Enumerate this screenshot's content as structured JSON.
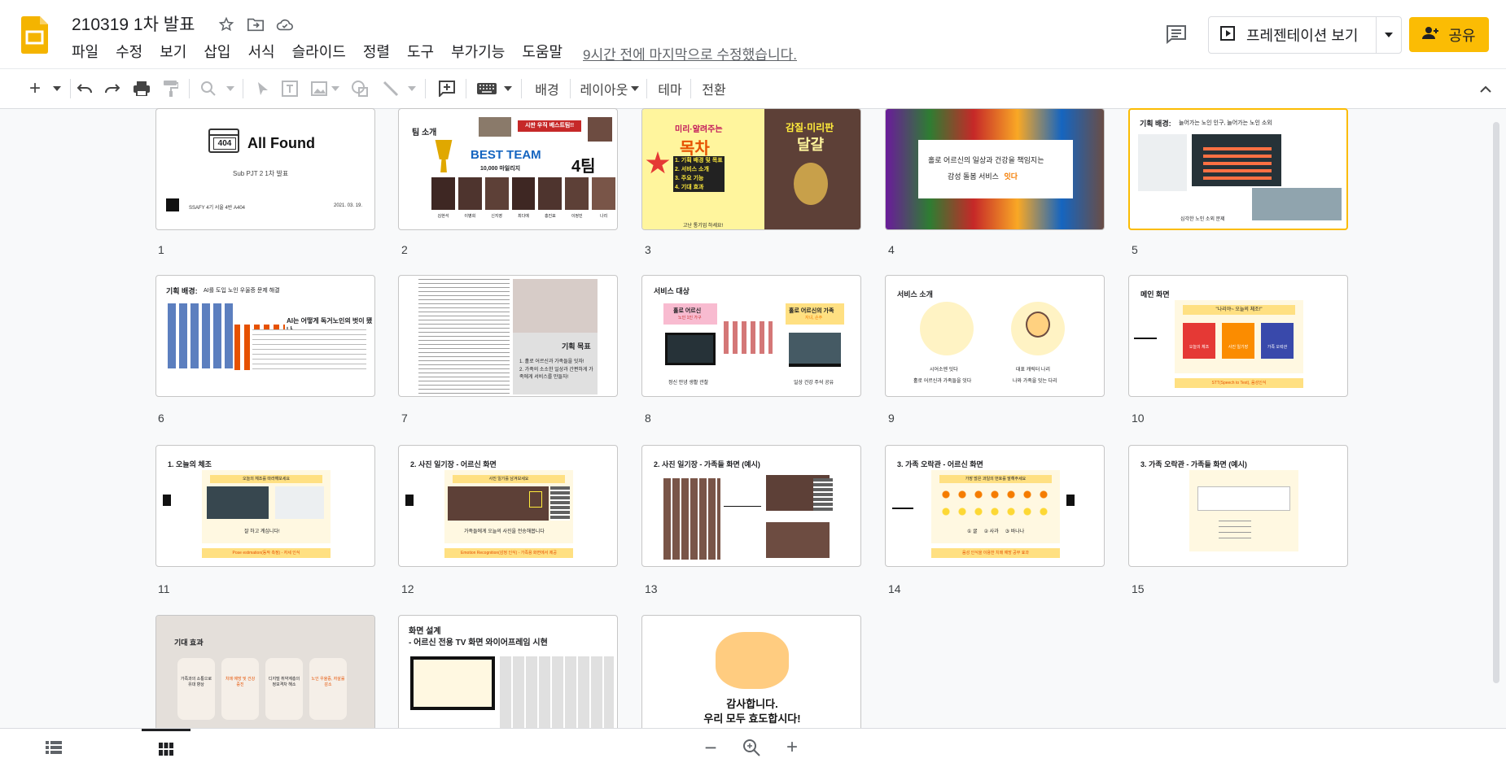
{
  "doc": {
    "title": "210319 1차 발표",
    "last_edit": "9시간 전에 마지막으로 수정했습니다."
  },
  "menu": [
    "파일",
    "수정",
    "보기",
    "삽입",
    "서식",
    "슬라이드",
    "정렬",
    "도구",
    "부가기능",
    "도움말"
  ],
  "header": {
    "present_label": "프레젠테이션 보기",
    "share_label": "공유"
  },
  "toolbar": {
    "background": "배경",
    "layout": "레이아웃",
    "theme": "테마",
    "transition": "전환"
  },
  "colors": {
    "accent": "#fbbc04",
    "logo": "#f4b400"
  },
  "slides": [
    {
      "n": "1",
      "title": "All Found",
      "subtitle": "Sub PJT 2 1차 발표",
      "footer": "SSAFY 4기 서울 4반 A404",
      "date": "2021. 03. 19.",
      "badge": "404"
    },
    {
      "n": "2",
      "title": "팀 소개",
      "headline": "BEST TEAM",
      "sub": "10,000 마일리지",
      "team": "4팀",
      "banner": "시판 우직 베스트팀!!",
      "members": [
        "김현석",
        "이병희",
        "신지영",
        "최다예",
        "홍진표",
        "이정민",
        "나리"
      ]
    },
    {
      "n": "3",
      "text1": "미리·알려주는",
      "text2": "목차",
      "text3": "감질·미리판",
      "text4": "달걀",
      "items": [
        "1. 기획 배경 및 목표",
        "2. 서비스 소개",
        "3. 주요 기능",
        "4. 기대 효과"
      ],
      "note": "고난 통기업 하세요!"
    },
    {
      "n": "4",
      "line1": "홀로 어르신의 일상과 건강을 책임지는",
      "line2": "감성 돌봄 서비스",
      "brand": "잇다"
    },
    {
      "n": "5",
      "title": "기획 배경:",
      "title2": "늘어가는 노인 인구, 늘어가는 노인 소외",
      "caption": "심각한 노인 소외 문제"
    },
    {
      "n": "6",
      "title": "기획 배경:",
      "title2": "AI를 도입 노인 우울증 문제 해결",
      "headline": "AI는 어떻게 독거노인의 벗이 됐나"
    },
    {
      "n": "7",
      "title": "기획 목표",
      "items": [
        "1. 홀로 어르신과 가족들을 잇자!",
        "2. 가족의 소소한 일상과 간편하게 가족에게 서비스를 만들자!"
      ]
    },
    {
      "n": "8",
      "title": "서비스 대상",
      "left": "홀로 어르신",
      "left_sub": "노인 1인 가구",
      "right": "홀로 어르신의 가족",
      "right_sub": "자녀, 손주",
      "left_foot": "정신 안녕 생활 관찰",
      "right_foot": "일상 건강 주석 공유"
    },
    {
      "n": "9",
      "title": "서비스 소개",
      "left_cap": "시어소엔 잇다",
      "left_sub": "홀로 어르신과 가족들을 잇다",
      "right_cap": "대표 캐릭터 나리",
      "right_sub": "나와 가족을 잇는 다리"
    },
    {
      "n": "10",
      "title": "메인 화면",
      "banner": "\"나리야~ 오늘의 체조!\"",
      "buttons": [
        "오늘의 체조",
        "사진 일기장",
        "가족 오락관"
      ],
      "foot": "STT(Speech to Text), 음성인식"
    },
    {
      "n": "11",
      "title": "1. 오늘의 체조",
      "banner": "오늘의 체조를 따라해보세요",
      "caption": "잘 하고 계십니다!",
      "foot": "Pose estimation(동작 측정) - 자세 인식"
    },
    {
      "n": "12",
      "title": "2. 사진 일기장 - 어르신 화면",
      "banner": "사진 일기를 남겨보세요",
      "caption": "가족들에게 오늘의 사진을 전송해봅니다",
      "foot": "Emotion Recognition(감정 인식) - 가족용 화면에서 제공"
    },
    {
      "n": "13",
      "title": "2. 사진 일기장 - 가족들 화면 (예시)"
    },
    {
      "n": "14",
      "title": "3. 가족 오락관 - 어르신 화면",
      "banner": "가장 많은 과일의 번호를 말해주세요",
      "options": [
        "① 귤",
        "② 사과",
        "③ 바나나"
      ],
      "foot": "음성 인식을 이용한 치매 예방 공부 효과"
    },
    {
      "n": "15",
      "title": "3. 가족 오락관 - 가족들 화면 (예시)"
    },
    {
      "n": "16",
      "title": "기대 효과",
      "effects": [
        "가족과의 소통으로 유대 향상",
        "치매 예방 및 건강 증진",
        "디지털 취약계층의 정보격차 해소",
        "노인 우울증, 자살률 감소"
      ]
    },
    {
      "n": "17",
      "title": "화면 설계",
      "title2": "- 어르신 전용 TV 화면 와이어프레임 시현"
    },
    {
      "n": "18",
      "line1": "감사합니다.",
      "line2": "우리 모두 효도합시다!"
    }
  ]
}
